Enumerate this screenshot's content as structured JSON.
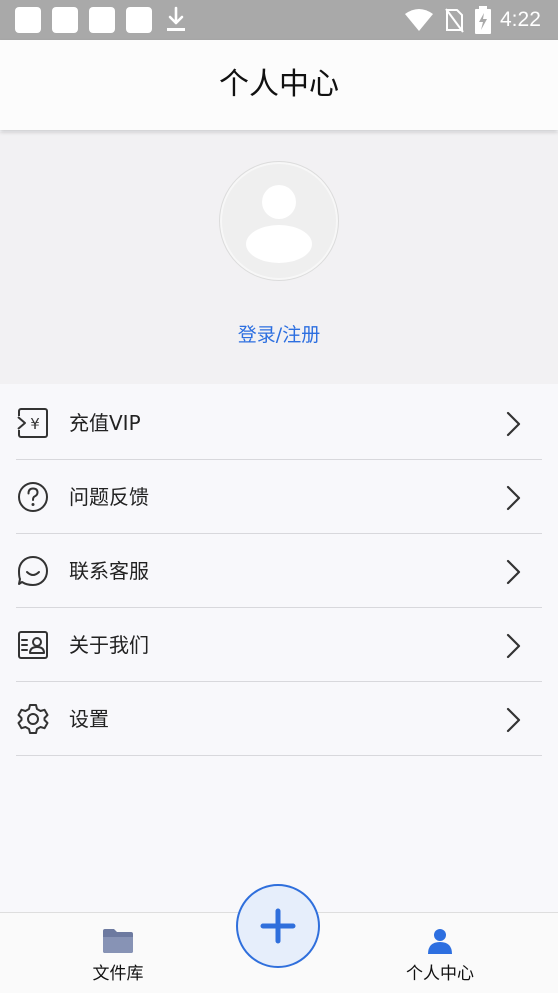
{
  "status_bar": {
    "time": "4:22",
    "icons": [
      "app-notification-icon",
      "app-notification-icon",
      "app-notification-icon",
      "app-notification-icon",
      "download-icon",
      "wifi-icon",
      "no-sim-icon",
      "battery-charging-icon"
    ]
  },
  "header": {
    "title": "个人中心"
  },
  "profile": {
    "avatar_icon": "default-avatar-icon",
    "login_label": "登录/注册"
  },
  "menu": {
    "items": [
      {
        "label": "充值VIP",
        "icon": "vip-recharge-icon"
      },
      {
        "label": "问题反馈",
        "icon": "question-circle-icon"
      },
      {
        "label": "联系客服",
        "icon": "chat-smile-icon"
      },
      {
        "label": "关于我们",
        "icon": "contact-card-icon"
      },
      {
        "label": "设置",
        "icon": "settings-gear-icon"
      }
    ]
  },
  "bottom_nav": {
    "items": [
      {
        "label": "文件库",
        "icon": "folder-icon",
        "active": false
      },
      {
        "label": "个人中心",
        "icon": "person-icon",
        "active": true
      }
    ],
    "fab_icon": "plus-icon"
  },
  "colors": {
    "accent": "#2d6fe0",
    "status_bar": "#a9a9a9",
    "profile_bg": "#f2f1f3",
    "page_bg": "#f8f8fb"
  }
}
